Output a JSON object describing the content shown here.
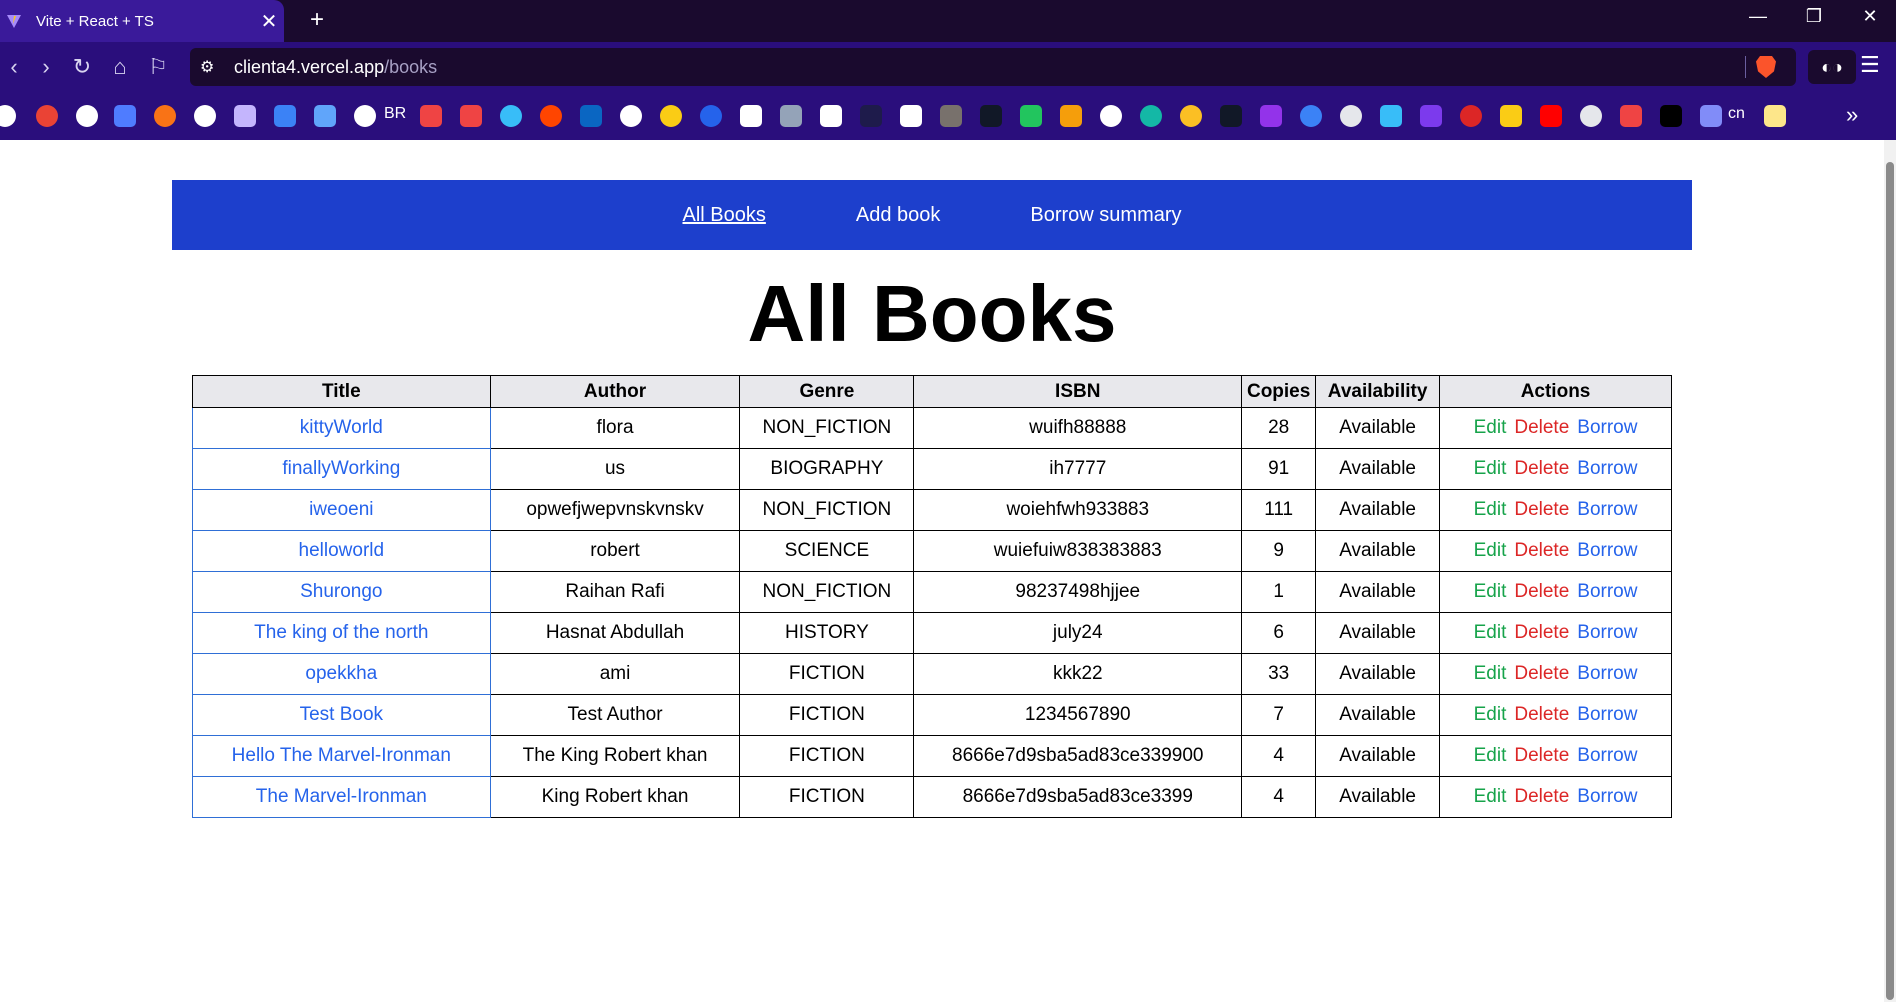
{
  "browser": {
    "tab_title": "Vite + React + TS",
    "tab_close": "✕",
    "new_tab": "+",
    "url_host": "clienta4.vercel.app",
    "url_path": "/books",
    "bookmark_br": "BR",
    "bookmark_cn": "cn",
    "minimize": "—",
    "restore": "❐",
    "close": "✕",
    "back": "‹",
    "forward": "›",
    "reload": "↻",
    "home": "⌂",
    "bookmark": "⚐",
    "menu": "☰",
    "more": "»",
    "ext": "◐◑",
    "tune": "⚙"
  },
  "nav": {
    "all_books": "All Books",
    "add_book": "Add book",
    "borrow_summary": "Borrow summary"
  },
  "page": {
    "heading": "All Books"
  },
  "table": {
    "headers": [
      "Title",
      "Author",
      "Genre",
      "ISBN",
      "Copies",
      "Availability",
      "Actions"
    ],
    "actions": {
      "edit": "Edit",
      "delete": "Delete",
      "borrow": "Borrow"
    },
    "rows": [
      {
        "title": "kittyWorld",
        "author": "flora",
        "genre": "NON_FICTION",
        "isbn": "wuifh88888",
        "copies": "28",
        "availability": "Available"
      },
      {
        "title": "finallyWorking",
        "author": "us",
        "genre": "BIOGRAPHY",
        "isbn": "ih7777",
        "copies": "91",
        "availability": "Available"
      },
      {
        "title": "iweoeni",
        "author": "opwefjwepvnskvnskv",
        "genre": "NON_FICTION",
        "isbn": "woiehfwh933883",
        "copies": "111",
        "availability": "Available"
      },
      {
        "title": "helloworld",
        "author": "robert",
        "genre": "SCIENCE",
        "isbn": "wuiefuiw838383883",
        "copies": "9",
        "availability": "Available"
      },
      {
        "title": "Shurongo",
        "author": "Raihan Rafi",
        "genre": "NON_FICTION",
        "isbn": "98237498hjjee",
        "copies": "1",
        "availability": "Available"
      },
      {
        "title": "The king of the north",
        "author": "Hasnat Abdullah",
        "genre": "HISTORY",
        "isbn": "july24",
        "copies": "6",
        "availability": "Available"
      },
      {
        "title": "opekkha",
        "author": "ami",
        "genre": "FICTION",
        "isbn": "kkk22",
        "copies": "33",
        "availability": "Available"
      },
      {
        "title": "Test Book",
        "author": "Test Author",
        "genre": "FICTION",
        "isbn": "1234567890",
        "copies": "7",
        "availability": "Available"
      },
      {
        "title": "Hello The Marvel-Ironman",
        "author": "The King Robert khan",
        "genre": "FICTION",
        "isbn": "8666e7d9sba5ad83ce339900",
        "copies": "4",
        "availability": "Available"
      },
      {
        "title": "The Marvel-Ironman",
        "author": "King Robert khan",
        "genre": "FICTION",
        "isbn": "8666e7d9sba5ad83ce3399",
        "copies": "4",
        "availability": "Available"
      }
    ]
  }
}
